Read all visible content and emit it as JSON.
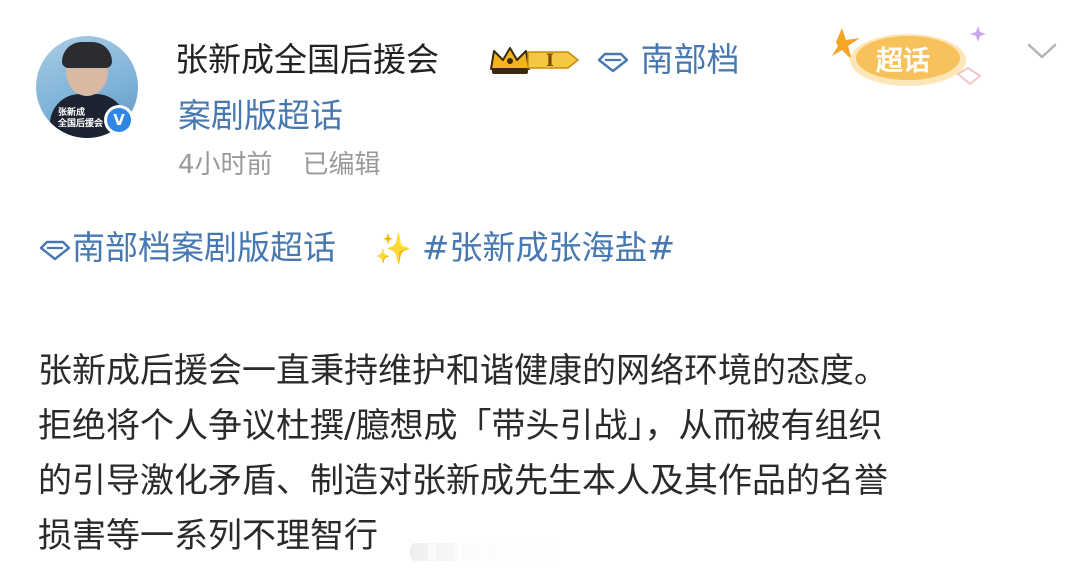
{
  "post": {
    "author_name": "张新成全国后援会",
    "member_level": "I",
    "topic_link_part1": "南部档",
    "topic_link_part2": "案剧版超话",
    "time_ago": "4小时前",
    "edited_label": "已编辑",
    "avatar_caption": "张新成\n全国后援会",
    "verified_mark": "V",
    "chaohua_badge": "超话",
    "topic_tag": "南部档案剧版超话",
    "hashtag": "#张新成张海盐#",
    "sparkle_icon": "sparkles-icon",
    "body_lines": [
      "张新成后援会一直秉持维护和谐健康的网络环境的态度。",
      "拒绝将个人争议杜撰/臆想成「带头引战」，从而被有组织",
      "的引导激化矛盾、制造对张新成先生本人及其作品的名誉",
      "损害等一系列不理智行"
    ]
  },
  "colors": {
    "link": "#4878b0",
    "verified": "#2f86e3",
    "meta": "#9a9a9a",
    "text": "#2a2a2a",
    "chaohua_orange": "#f5a623"
  }
}
